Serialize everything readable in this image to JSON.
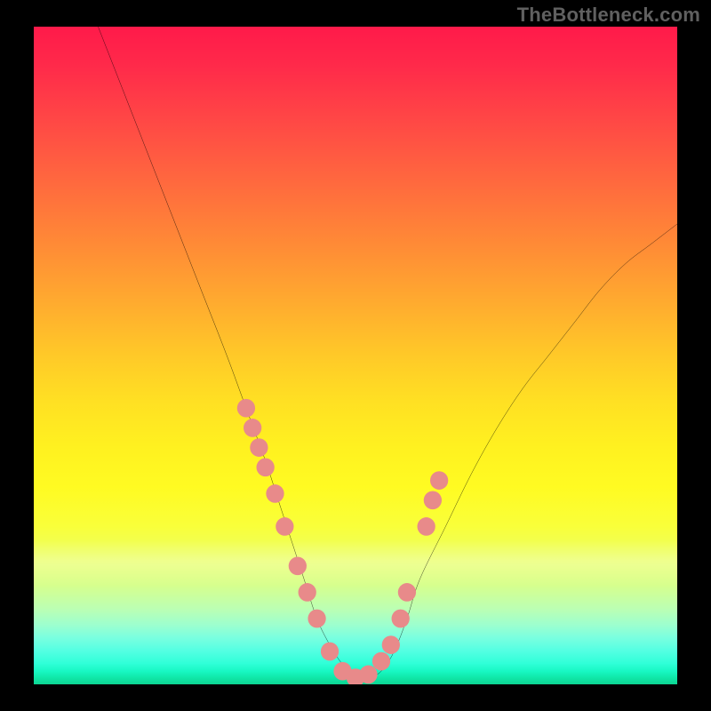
{
  "watermark": "TheBottleneck.com",
  "chart_data": {
    "type": "line",
    "title": "",
    "xlabel": "",
    "ylabel": "",
    "xlim": [
      0,
      100
    ],
    "ylim": [
      0,
      100
    ],
    "grid": false,
    "legend": false,
    "background": "rainbow-vertical-gradient",
    "series": [
      {
        "name": "bottleneck-curve",
        "color": "#000000",
        "x": [
          10,
          14,
          18,
          22,
          26,
          30,
          33,
          36,
          38,
          40,
          42,
          44,
          46,
          48,
          50,
          52,
          54,
          56,
          58,
          60,
          64,
          68,
          72,
          76,
          80,
          84,
          88,
          92,
          96,
          100
        ],
        "y": [
          100,
          90,
          80,
          70,
          60,
          50,
          42,
          34,
          28,
          22,
          16,
          10,
          6,
          3,
          1,
          1,
          2,
          5,
          10,
          16,
          24,
          32,
          39,
          45,
          50,
          55,
          60,
          64,
          67,
          70
        ]
      }
    ],
    "markers": [
      {
        "name": "data-points",
        "color": "#e88a8a",
        "radius": 1.4,
        "x": [
          33,
          34,
          35,
          36,
          37.5,
          39,
          41,
          42.5,
          44,
          46,
          48,
          50,
          52,
          54,
          55.5,
          57,
          58,
          61,
          62,
          63
        ],
        "y": [
          42,
          39,
          36,
          33,
          29,
          24,
          18,
          14,
          10,
          5,
          2,
          1,
          1.5,
          3.5,
          6,
          10,
          14,
          24,
          28,
          31
        ]
      }
    ]
  },
  "colors": {
    "frame": "#000000",
    "curve": "#000000",
    "marker": "#e88a8a"
  }
}
